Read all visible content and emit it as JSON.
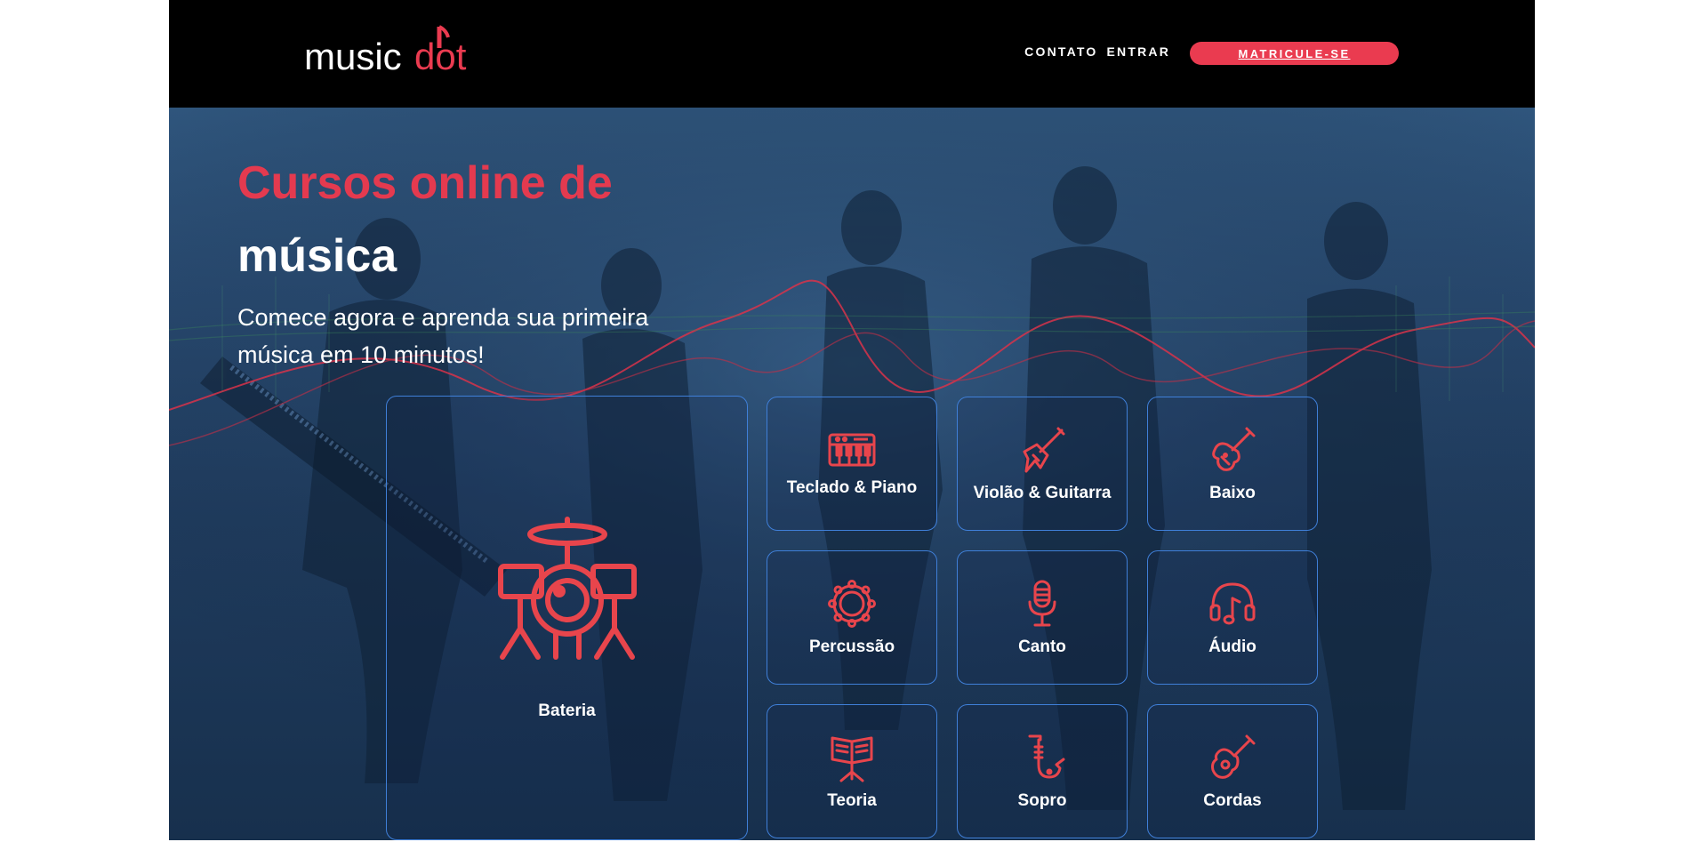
{
  "header": {
    "logo_text_a": "music",
    "logo_text_b": "dot",
    "nav": [
      {
        "label": "CONTATO"
      },
      {
        "label": "ENTRAR"
      }
    ],
    "cta_label": "MATRICULE-SE"
  },
  "hero": {
    "title_line1": "Cursos online de",
    "title_line2": "música",
    "subtitle": "Comece agora e aprenda sua primeira música em 10 minutos!"
  },
  "courses": [
    {
      "label": "Bateria",
      "icon": "drum-kit-icon"
    },
    {
      "label": "Teclado & Piano",
      "icon": "keyboard-icon"
    },
    {
      "label": "Violão & Guitarra",
      "icon": "electric-guitar-icon"
    },
    {
      "label": "Baixo",
      "icon": "bass-guitar-icon"
    },
    {
      "label": "Percussão",
      "icon": "tambourine-icon"
    },
    {
      "label": "Canto",
      "icon": "microphone-icon"
    },
    {
      "label": "Áudio",
      "icon": "headphones-icon"
    },
    {
      "label": "Teoria",
      "icon": "music-stand-icon"
    },
    {
      "label": "Sopro",
      "icon": "saxophone-icon"
    },
    {
      "label": "Cordas",
      "icon": "ukulele-icon"
    }
  ],
  "colors": {
    "accent": "#ea3b50",
    "card_border": "#3f7fd8",
    "hero_bg": "#1f3b5d",
    "header_bg": "#000000"
  }
}
